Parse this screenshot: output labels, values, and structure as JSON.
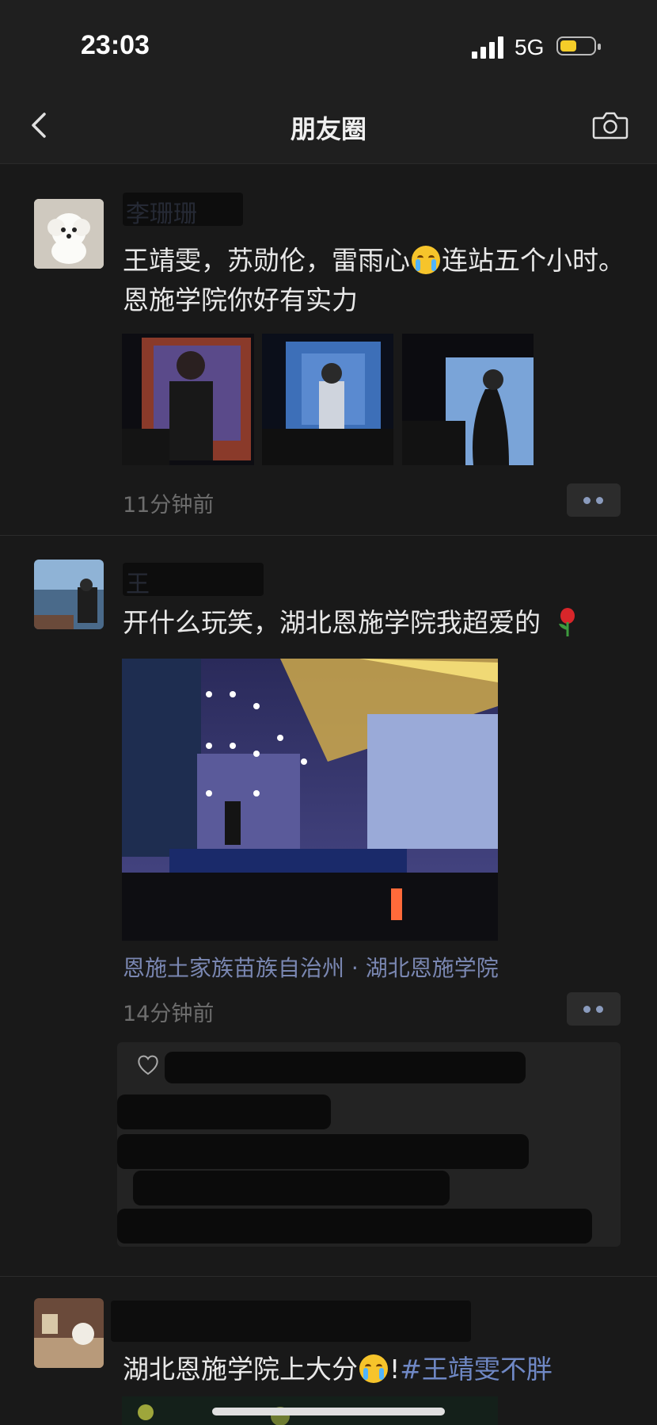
{
  "status_bar": {
    "time": "23:03",
    "network": "5G"
  },
  "nav": {
    "title": "朋友圈"
  },
  "posts": [
    {
      "author": "李珊珊",
      "text_before_emoji": "王靖雯，苏勋伦，雷雨心",
      "text_after_emoji": "连站五个小时。恩施学院你好有实力",
      "time_ago": "11分钟前"
    },
    {
      "author": "王",
      "text": "开什么玩笑，湖北恩施学院我超爱的",
      "location": "恩施土家族苗族自治州 · 湖北恩施学院",
      "time_ago": "14分钟前"
    },
    {
      "author": "",
      "text_before_emoji": "湖北恩施学院上大分",
      "text_after_emoji": "!",
      "hashtag": "#王靖雯不胖"
    }
  ],
  "icons": [
    "back-chevron-icon",
    "camera-icon",
    "more-dots-icon",
    "heart-icon",
    "crying-emoji-icon",
    "rose-emoji-icon"
  ]
}
